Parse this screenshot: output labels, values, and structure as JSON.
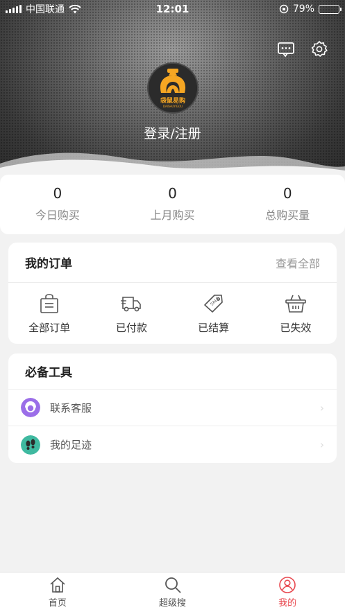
{
  "status_bar": {
    "carrier": "中国联通",
    "time": "12:01",
    "battery": "79%",
    "battery_level": 0.79
  },
  "header": {
    "brand_logo_text": "袋鼠易购",
    "brand_logo_subtext": "DAISHUYIGOU",
    "login_label": "登录/注册"
  },
  "stats": [
    {
      "value": "0",
      "label": "今日购买"
    },
    {
      "value": "0",
      "label": "上月购买"
    },
    {
      "value": "0",
      "label": "总购买量"
    }
  ],
  "orders": {
    "title": "我的订单",
    "view_all": "查看全部",
    "items": [
      {
        "label": "全部订单",
        "icon": "shopping-bag-icon"
      },
      {
        "label": "已付款",
        "icon": "delivery-truck-icon"
      },
      {
        "label": "已结算",
        "icon": "sale-tag-icon"
      },
      {
        "label": "已失效",
        "icon": "basket-icon"
      }
    ]
  },
  "tools": {
    "title": "必备工具",
    "items": [
      {
        "label": "联系客服",
        "icon": "customer-service-icon",
        "color": "#9b6ee8"
      },
      {
        "label": "我的足迹",
        "icon": "footprints-icon",
        "color": "#3fb9a0"
      }
    ]
  },
  "tabbar": {
    "items": [
      {
        "label": "首页",
        "icon": "home-icon"
      },
      {
        "label": "超级搜",
        "icon": "search-icon"
      },
      {
        "label": "我的",
        "icon": "profile-icon",
        "active": true
      }
    ],
    "active_color": "#e8484f"
  }
}
